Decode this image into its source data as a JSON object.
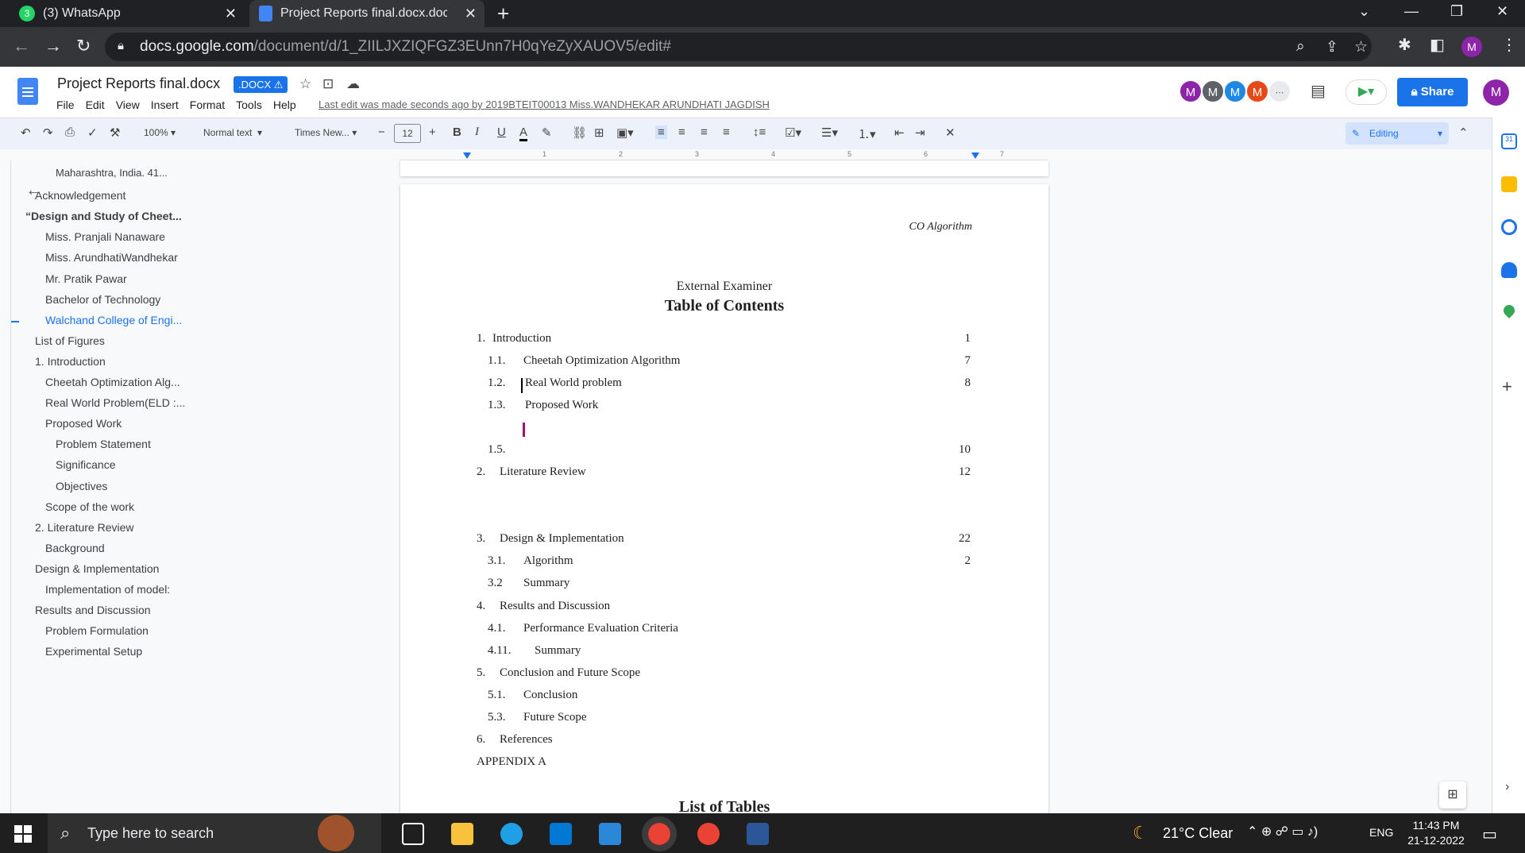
{
  "browser": {
    "tabs": [
      {
        "title": "(3) WhatsApp",
        "badge": "3"
      },
      {
        "title": "Project Reports final.docx.docx - "
      }
    ],
    "url_host": "docs.google.com",
    "url_path": "/document/d/1_ZIILJXZIQFGZ3EUnn7H0qYeZyXAUOV5/edit#",
    "profile_initial": "M"
  },
  "docs": {
    "title": "Project Reports final.docx",
    "badge": ".DOCX",
    "menu": [
      "File",
      "Edit",
      "View",
      "Insert",
      "Format",
      "Tools",
      "Help"
    ],
    "last_edit": "Last edit was made seconds ago by 2019BTEIT00013 Miss.WANDHEKAR ARUNDHATI JAGDISH",
    "collaborators": [
      "M",
      "M",
      "M",
      "M"
    ],
    "share_label": "Share",
    "user_initial": "M"
  },
  "toolbar": {
    "zoom": "100%",
    "style": "Normal text",
    "font": "Times New...",
    "font_size": "12",
    "mode": "Editing"
  },
  "colors": {
    "accent": "#1a73e8",
    "avatar1": "#8e24aa",
    "avatar2": "#5f6368",
    "avatar3": "#1e88e5",
    "avatar4": "#e64a19",
    "tabbar": "#202124"
  },
  "ruler": [
    "1",
    "2",
    "3",
    "4",
    "5",
    "6",
    "7"
  ],
  "outline": [
    {
      "text": "Maharashtra, India. 41...",
      "level": 3
    },
    {
      "text": "Acknowledgement",
      "level": 1
    },
    {
      "text": "“Design and Study of Cheet...",
      "level": 0
    },
    {
      "text": "Miss. Pranjali Nanaware",
      "level": 2
    },
    {
      "text": "Miss. ArundhatiWandhekar",
      "level": 2
    },
    {
      "text": "Mr. Pratik Pawar",
      "level": 2
    },
    {
      "text": "Bachelor of Technology",
      "level": 2
    },
    {
      "text": "Walchand College of Engi...",
      "level": 2,
      "active": true
    },
    {
      "text": "List of Figures",
      "level": 1
    },
    {
      "text": "1. Introduction",
      "level": 1
    },
    {
      "text": "Cheetah Optimization Alg...",
      "level": 2
    },
    {
      "text": "Real World Problem(ELD :...",
      "level": 2
    },
    {
      "text": "Proposed Work",
      "level": 2
    },
    {
      "text": "Problem Statement",
      "level": 3
    },
    {
      "text": "Significance",
      "level": 3
    },
    {
      "text": "Objectives",
      "level": 3
    },
    {
      "text": "Scope of the work",
      "level": 2
    },
    {
      "text": "2. Literature Review",
      "level": 1
    },
    {
      "text": "Background",
      "level": 2
    },
    {
      "text": "Design & Implementation",
      "level": 1
    },
    {
      "text": "Implementation of model:",
      "level": 2
    },
    {
      "text": "Results and Discussion",
      "level": 1
    },
    {
      "text": "Problem Formulation",
      "level": 2
    },
    {
      "text": "Experimental Setup",
      "level": 2
    }
  ],
  "page": {
    "header": "CO Algorithm",
    "examiner": "External Examiner",
    "toc_title": "Table of Contents",
    "toc": [
      {
        "num": "1.",
        "title": "Introduction",
        "page": "1"
      },
      {
        "num": "1.1.",
        "title": "Cheetah Optimization Algorithm",
        "page": "7"
      },
      {
        "num": "1.2.",
        "title": "Real World problem",
        "page": "8"
      },
      {
        "num": "1.3.",
        "title": "Proposed Work",
        "page": ""
      },
      {
        "num": "1.5.",
        "title": "",
        "page": "10"
      },
      {
        "num": "2.",
        "title": "Literature Review",
        "page": "12"
      },
      {
        "num": "3.",
        "title": "Design & Implementation",
        "page": "22"
      },
      {
        "num": "3.1.",
        "title": "Algorithm",
        "page": "2"
      },
      {
        "num": "3.2",
        "title": "Summary",
        "page": ""
      },
      {
        "num": "4.",
        "title": "Results and Discussion",
        "page": ""
      },
      {
        "num": "4.1.",
        "title": "Performance Evaluation Criteria",
        "page": ""
      },
      {
        "num": "4.11.",
        "title": "Summary",
        "page": ""
      },
      {
        "num": "5.",
        "title": "Conclusion and Future Scope",
        "page": ""
      },
      {
        "num": "5.1.",
        "title": "Conclusion",
        "page": ""
      },
      {
        "num": "5.3.",
        "title": "Future Scope",
        "page": ""
      },
      {
        "num": "6.",
        "title": "References",
        "page": ""
      },
      {
        "num": "",
        "title": "APPENDIX A",
        "page": ""
      }
    ],
    "list_of_tables_title": "List of Tables"
  },
  "taskbar": {
    "search_placeholder": "Type here to search",
    "weather": "21°C  Clear",
    "lang": "ENG",
    "time": "11:43 PM",
    "date": "21-12-2022"
  }
}
